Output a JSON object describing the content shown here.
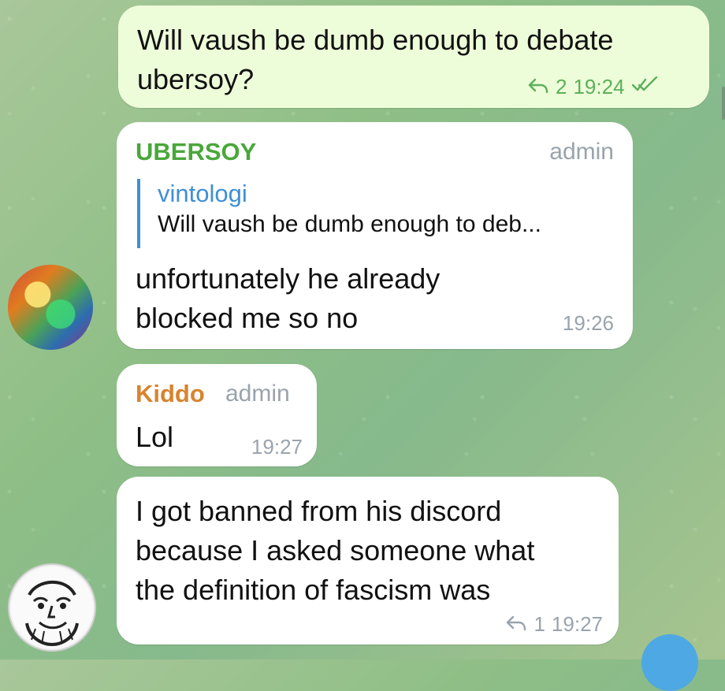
{
  "messages": [
    {
      "id": "m1",
      "type": "outgoing",
      "text_lines": [
        "Will vaush be dumb enough to debate",
        "ubersoy?"
      ],
      "reply_count": "2",
      "time": "19:24",
      "status": "read"
    },
    {
      "id": "m2",
      "type": "incoming",
      "sender": "UBERSOY",
      "sender_color": "#4aa73b",
      "admin": "admin",
      "reply_to": {
        "name": "vintologi",
        "text": "Will vaush be dumb enough to deb..."
      },
      "text_lines": [
        "unfortunately he already",
        "blocked me so no"
      ],
      "time": "19:26"
    },
    {
      "id": "m3",
      "type": "incoming",
      "sender": "Kiddo",
      "sender_color": "#d9832f",
      "admin": "admin",
      "text_lines": [
        "Lol"
      ],
      "time": "19:27"
    },
    {
      "id": "m4",
      "type": "incoming",
      "text_lines": [
        "I got banned from his discord",
        "because I asked someone what",
        "the definition of fascism was"
      ],
      "reply_count": "1",
      "time": "19:27"
    }
  ],
  "colors": {
    "outgoing_bubble": "#eefdd9",
    "incoming_bubble": "#ffffff",
    "reply_accent": "#3e8fd6",
    "meta_out": "#5bb05a",
    "meta_in": "#9aa3ad"
  },
  "icons": {
    "reply": "reply-arrow",
    "read": "double-check"
  }
}
